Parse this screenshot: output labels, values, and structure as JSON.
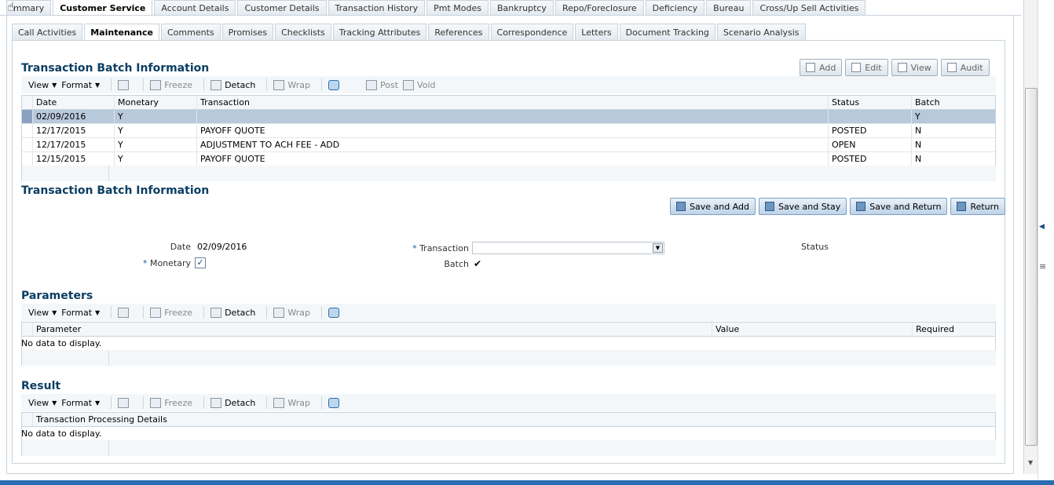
{
  "top_tabs": [
    "mmary",
    "Customer Service",
    "Account Details",
    "Customer Details",
    "Transaction History",
    "Pmt Modes",
    "Bankruptcy",
    "Repo/Foreclosure",
    "Deficiency",
    "Bureau",
    "Cross/Up Sell Activities"
  ],
  "top_active": 1,
  "sub_tabs": [
    "Call Activities",
    "Maintenance",
    "Comments",
    "Promises",
    "Checklists",
    "Tracking Attributes",
    "References",
    "Correspondence",
    "Letters",
    "Document Tracking",
    "Scenario Analysis"
  ],
  "sub_active": 1,
  "toolbar": {
    "view": "View",
    "format": "Format",
    "freeze": "Freeze",
    "detach": "Detach",
    "wrap": "Wrap",
    "post": "Post",
    "void": "Void"
  },
  "section1": {
    "title": "Transaction Batch Information",
    "actions": [
      "Add",
      "Edit",
      "View",
      "Audit"
    ],
    "columns": [
      "Date",
      "Monetary",
      "Transaction",
      "Status",
      "Batch"
    ],
    "rows": [
      [
        "02/09/2016",
        "Y",
        "",
        "",
        "Y"
      ],
      [
        "12/17/2015",
        "Y",
        "PAYOFF QUOTE",
        "POSTED",
        "N"
      ],
      [
        "12/17/2015",
        "Y",
        "ADJUSTMENT TO ACH FEE - ADD",
        "OPEN",
        "N"
      ],
      [
        "12/15/2015",
        "Y",
        "PAYOFF QUOTE",
        "POSTED",
        "N"
      ]
    ]
  },
  "section2": {
    "title": "Transaction Batch Information",
    "buttons": [
      "Save and Add",
      "Save and Stay",
      "Save and Return",
      "Return"
    ],
    "date_label": "Date",
    "date_value": "02/09/2016",
    "monetary_label": "Monetary",
    "required_mark": "*",
    "transaction_label": "Transaction",
    "transaction_value": "",
    "batch_label": "Batch",
    "status_label": "Status",
    "monetary_checked": true,
    "batch_checked": true
  },
  "section3": {
    "title": "Parameters",
    "columns": [
      "Parameter",
      "Value",
      "Required"
    ],
    "empty": "No data to display."
  },
  "section4": {
    "title": "Result",
    "columns": [
      "Transaction Processing Details"
    ],
    "empty": "No data to display."
  }
}
